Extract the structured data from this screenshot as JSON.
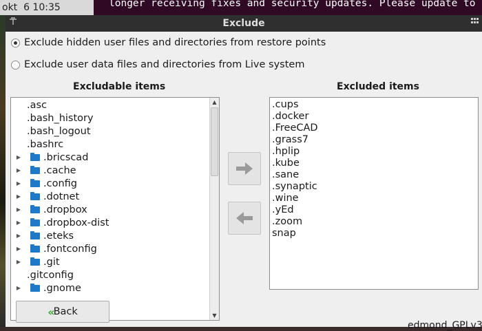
{
  "background": {
    "clock": "okt  6 10:35",
    "terminal_text": "longer receiving fixes and security updates. Please update to"
  },
  "window": {
    "title": "Exclude",
    "pin_icon": "pin-icon",
    "menu_icon": "window-menu-icon"
  },
  "options": {
    "hidden": "Exclude hidden user files and directories from restore points",
    "data": "Exclude user data files and directories from Live system",
    "selected": "hidden"
  },
  "left": {
    "header": "Excludable items",
    "items": [
      {
        "label": ".asc",
        "folder": false
      },
      {
        "label": ".bash_history",
        "folder": false
      },
      {
        "label": ".bash_logout",
        "folder": false
      },
      {
        "label": ".bashrc",
        "folder": false
      },
      {
        "label": ".bricscad",
        "folder": true
      },
      {
        "label": ".cache",
        "folder": true
      },
      {
        "label": ".config",
        "folder": true
      },
      {
        "label": ".dotnet",
        "folder": true
      },
      {
        "label": ".dropbox",
        "folder": true
      },
      {
        "label": ".dropbox-dist",
        "folder": true
      },
      {
        "label": ".eteks",
        "folder": true
      },
      {
        "label": ".fontconfig",
        "folder": true
      },
      {
        "label": ".git",
        "folder": true
      },
      {
        "label": ".gitconfig",
        "folder": false
      },
      {
        "label": ".gnome",
        "folder": true
      }
    ]
  },
  "right": {
    "header": "Excluded items",
    "items": [
      ".cups",
      ".docker",
      ".FreeCAD",
      ".grass7",
      ".hplip",
      ".kube",
      ".sane",
      ".synaptic",
      ".wine",
      ".yEd",
      ".zoom",
      "snap"
    ]
  },
  "buttons": {
    "add_icon": "arrow-right-icon",
    "remove_icon": "arrow-left-icon",
    "back_icon": "double-chevron-left-icon",
    "back": "Back"
  },
  "footer": "edmond_GPLv3",
  "colors": {
    "folder": "#1e79c9",
    "back_icon": "#3fa63a",
    "titlebar": "#2f2f2f",
    "terminal": "#300a24"
  }
}
